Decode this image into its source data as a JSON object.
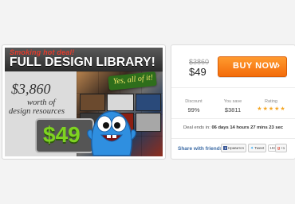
{
  "promo": {
    "banner_subtitle": "Smoking hot deal!",
    "banner_title": "FULL DESIGN LIBRARY!",
    "worth_price": "$3,860",
    "worth_line": "worth of",
    "resources_line": "design resources",
    "tag_text": "Yes, all of it!",
    "deal_price": "$49"
  },
  "panel": {
    "old_price": "$3860",
    "new_price": "$49",
    "buy_label": "BUY NOW",
    "buy_arrow": "›",
    "stats": {
      "discount_label": "Discount",
      "discount_value": "99%",
      "save_label": "You save",
      "save_value": "$3811",
      "rating_label": "Rating",
      "rating_value": 5
    },
    "deal_ends_label": "Deal ends in:",
    "deal_ends_time": "06 days 14 hours 27 mins 23 sec",
    "share_label": "Share with friends",
    "social": {
      "facebook_label": "Нравится",
      "twitter_label": "Tweet",
      "twitter_count": "193",
      "gplus_label": "+1"
    }
  },
  "colors": {
    "accent_orange": "#f36c0b",
    "share_blue": "#3b6aa4",
    "deal_green": "#7ed321",
    "star": "#f5a623"
  }
}
